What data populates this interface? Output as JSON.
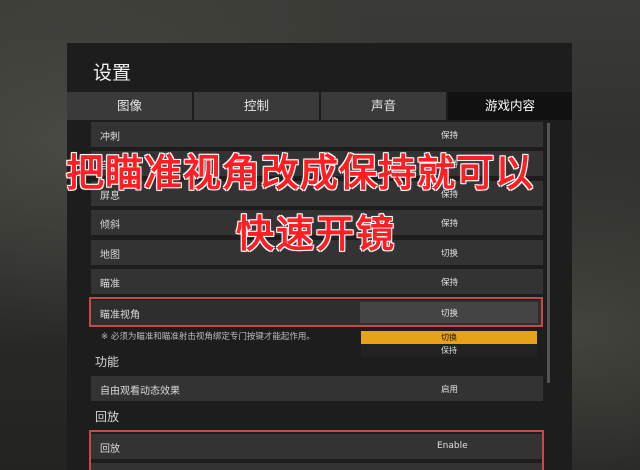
{
  "window": {
    "title": "设置"
  },
  "tabs": [
    {
      "label": "图像",
      "active": false
    },
    {
      "label": "控制",
      "active": false
    },
    {
      "label": "声音",
      "active": false
    },
    {
      "label": "游戏内容",
      "active": true
    }
  ],
  "settings_rows": [
    {
      "label": "冲刺",
      "value": "保持"
    },
    {
      "label": "自由视角",
      "value": "保持"
    },
    {
      "label": "屏息",
      "value": "保持"
    },
    {
      "label": "倾斜",
      "value": "保持"
    },
    {
      "label": "地图",
      "value": "切换"
    },
    {
      "label": "瞄准",
      "value": "保持"
    },
    {
      "label": "瞄准视角",
      "value": "切换"
    }
  ],
  "dropdown": {
    "options": [
      {
        "label": "切换",
        "highlighted": true
      },
      {
        "label": "保持",
        "highlighted": false
      }
    ]
  },
  "note": "※ 必须为瞄准和瞄准射击视角绑定专门按键才能起作用。",
  "section_function": {
    "title": "功能",
    "rows": [
      {
        "label": "自由观看动态效果",
        "value": "启用"
      }
    ]
  },
  "section_replay": {
    "title": "回放",
    "rows": [
      {
        "label": "回放",
        "value": "Enable"
      }
    ]
  },
  "annotation": {
    "line1": "把瞄准视角改成保持就可以",
    "line2": "快速开镜",
    "color": "#ff1e24"
  },
  "colors": {
    "panel": "#1d1d1d",
    "row": "#333333",
    "tab": "#3a3a3a",
    "tab_active": "#111111",
    "accent": "#e6a219",
    "highlight_border": "#c54b4b"
  }
}
